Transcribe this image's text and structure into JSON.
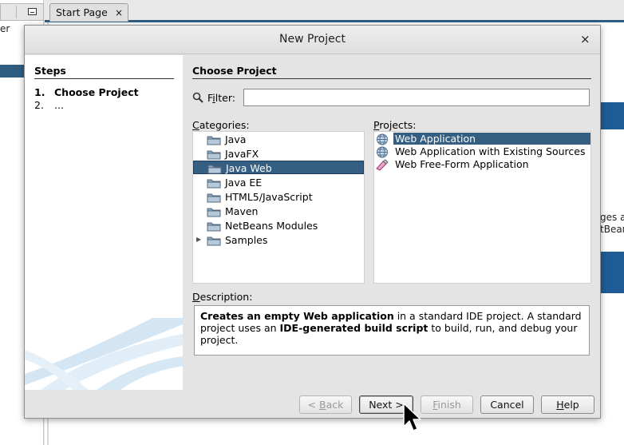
{
  "background": {
    "tab_title": "Start Page",
    "tab_close": "×",
    "left_panel_text": "er",
    "side_text_lines": [
      "ges a",
      "tBean"
    ]
  },
  "dialog": {
    "title": "New Project",
    "close_glyph": "×"
  },
  "steps": {
    "heading": "Steps",
    "items": [
      {
        "num": "1.",
        "label": "Choose Project"
      },
      {
        "num": "2.",
        "label": "..."
      }
    ]
  },
  "content": {
    "heading": "Choose Project",
    "filter": {
      "label_mnemonic": "i",
      "label_prefix": "F",
      "label_suffix": "lter:",
      "value": ""
    },
    "categories_label_mnemonic": "C",
    "categories_label_rest": "ategories:",
    "projects_label_mnemonic": "P",
    "projects_label_rest": "rojects:",
    "categories": [
      {
        "label": "Java",
        "selected": false
      },
      {
        "label": "JavaFX",
        "selected": false
      },
      {
        "label": "Java Web",
        "selected": true
      },
      {
        "label": "Java EE",
        "selected": false
      },
      {
        "label": "HTML5/JavaScript",
        "selected": false
      },
      {
        "label": "Maven",
        "selected": false
      },
      {
        "label": "NetBeans Modules",
        "selected": false
      },
      {
        "label": "Samples",
        "selected": false,
        "expander": "▶"
      }
    ],
    "projects": [
      {
        "label": "Web Application",
        "icon": "globe-icon",
        "selected": true
      },
      {
        "label": "Web Application with Existing Sources",
        "icon": "globe-icon",
        "selected": false
      },
      {
        "label": "Web Free-Form Application",
        "icon": "freeform-icon",
        "selected": false
      }
    ],
    "description_label_mnemonic": "D",
    "description_label_rest": "escription:",
    "description": {
      "bold1": "Creates an empty Web application",
      "text1": " in a standard IDE project. A standard project uses an ",
      "bold2": "IDE-generated build script",
      "text2": " to build, run, and debug your project."
    }
  },
  "buttons": {
    "back_prefix": "< ",
    "back_mnemonic": "B",
    "back_rest": "ack",
    "next": "Next >",
    "finish_mnemonic": "F",
    "finish_rest": "inish",
    "cancel": "Cancel",
    "help_mnemonic": "H",
    "help_rest": "elp"
  },
  "colors": {
    "selection": "#345f83",
    "accent_blue": "#1f5b96"
  }
}
